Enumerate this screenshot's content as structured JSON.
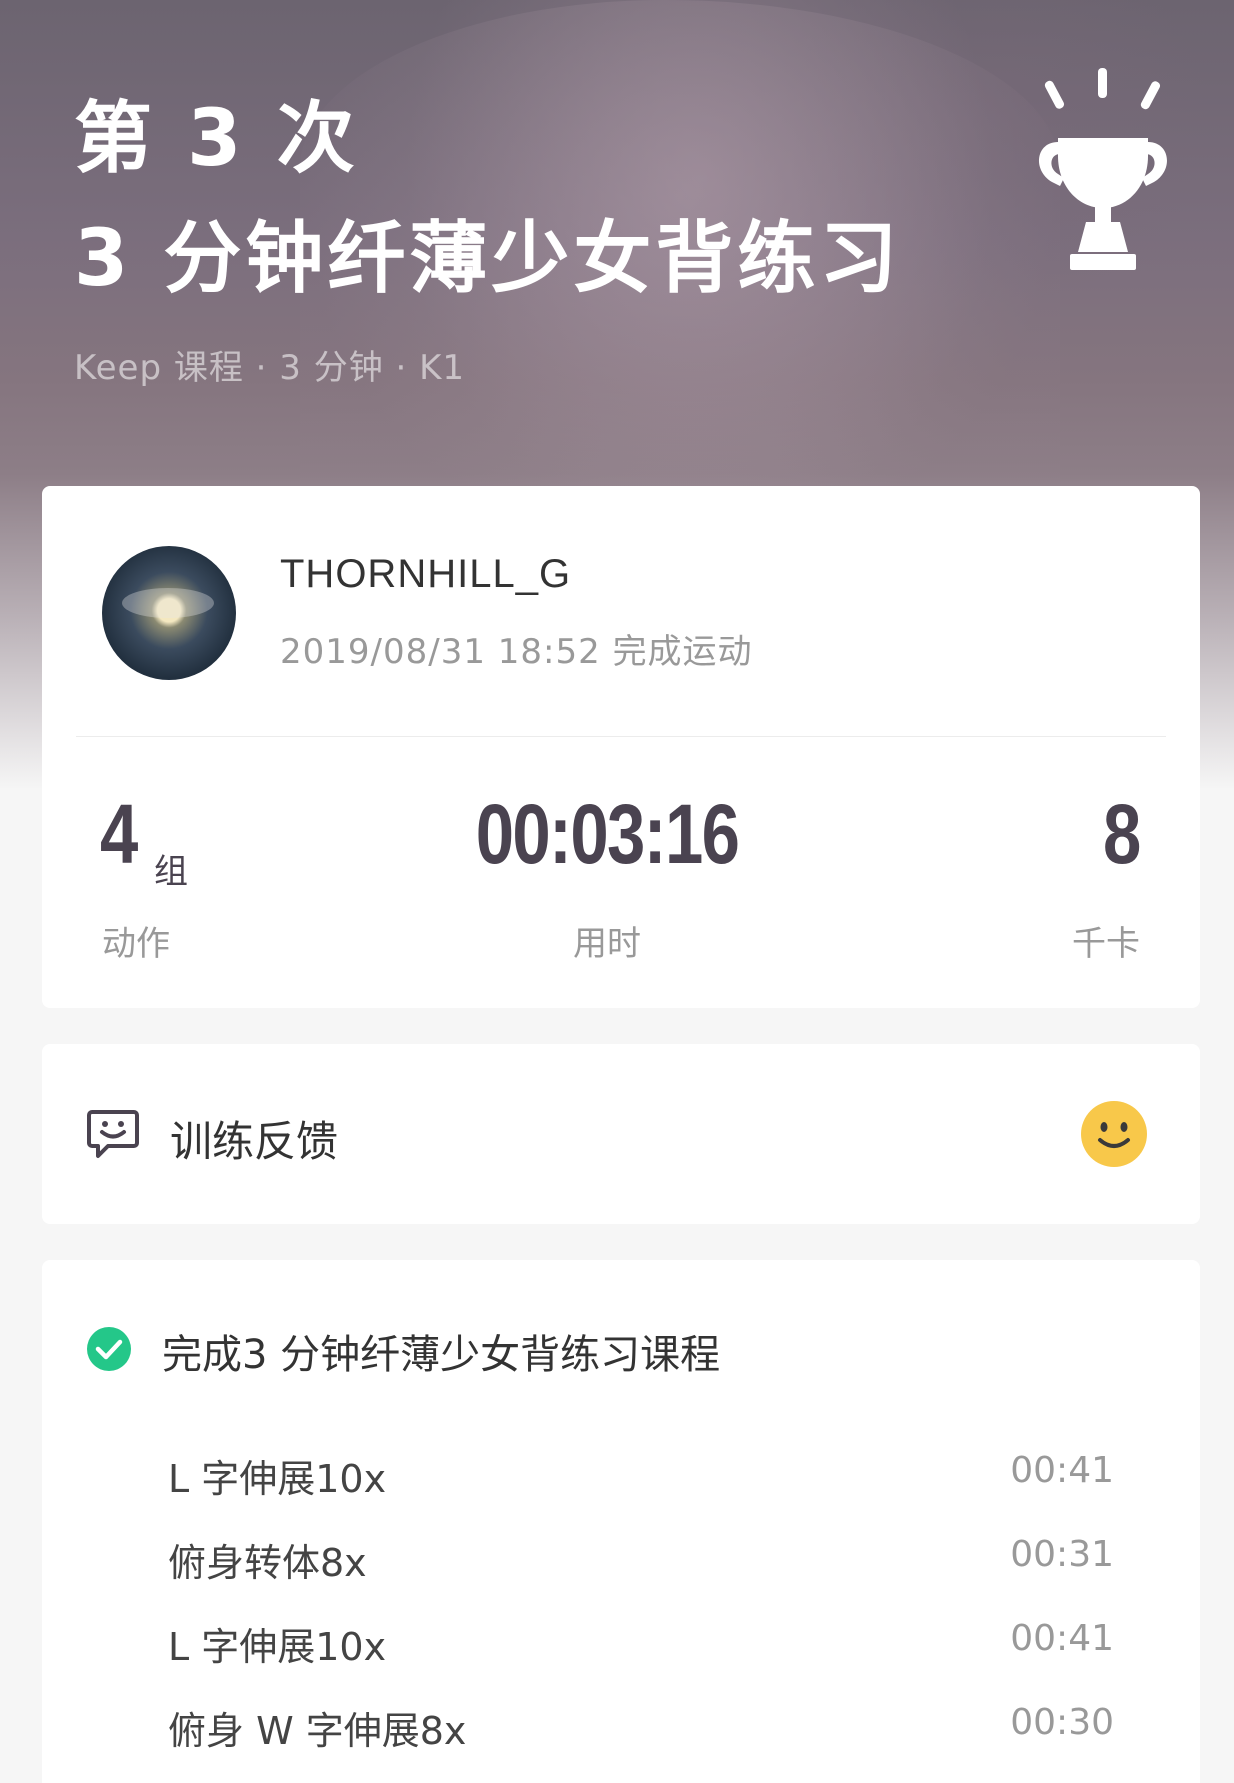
{
  "header": {
    "attempt": "第 3 次",
    "course_title": "3 分钟纤薄少女背练习",
    "meta": "Keep 课程 · 3 分钟 · K1",
    "trophy_icon": "trophy-icon"
  },
  "user": {
    "name": "THORNHILL_G",
    "finished_at": "2019/08/31 18:52 完成运动"
  },
  "stats": {
    "sets": {
      "value": "4",
      "unit": "组",
      "label": "动作"
    },
    "duration": {
      "value": "00:03:16",
      "label": "用时"
    },
    "calories": {
      "value": "8",
      "label": "千卡"
    }
  },
  "feedback": {
    "label": "训练反馈",
    "icon": "feedback-chat-icon",
    "mood_icon": "smiley-icon",
    "mood_color": "#F8C84A"
  },
  "course": {
    "complete_label": "完成3 分钟纤薄少女背练习课程",
    "check_color": "#24C789",
    "exercises": [
      {
        "name": "L 字伸展10x",
        "time": "00:41"
      },
      {
        "name": "俯身转体8x",
        "time": "00:31"
      },
      {
        "name": "L 字伸展10x",
        "time": "00:41"
      },
      {
        "name": "俯身 W 字伸展8x",
        "time": "00:30"
      }
    ]
  }
}
